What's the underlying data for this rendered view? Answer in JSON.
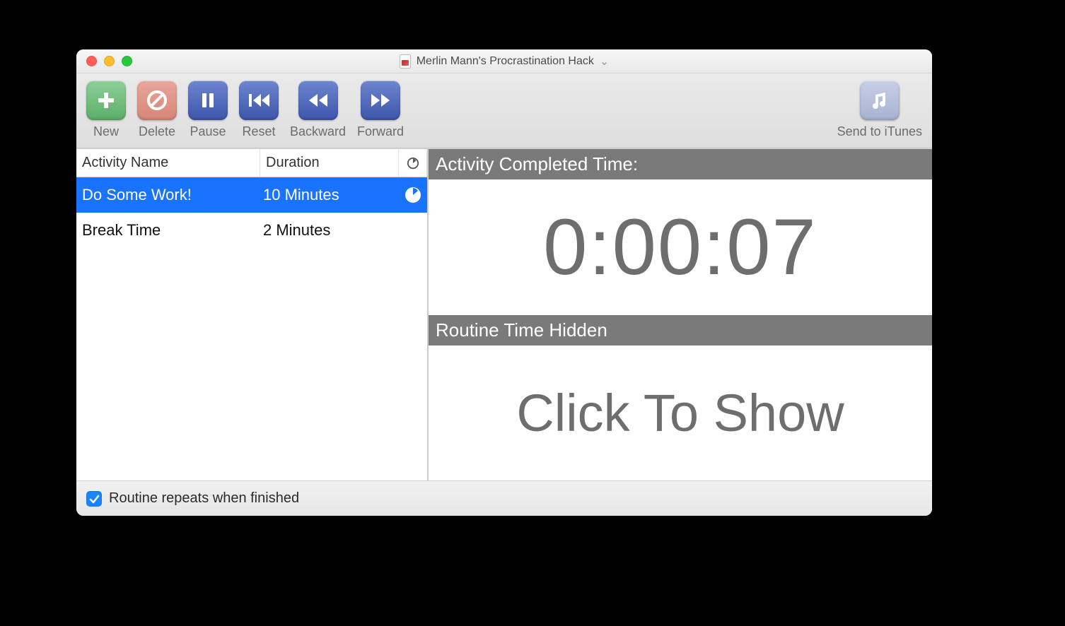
{
  "window": {
    "title": "Merlin Mann's Procrastination Hack"
  },
  "toolbar": {
    "new": "New",
    "delete": "Delete",
    "pause": "Pause",
    "reset": "Reset",
    "backward": "Backward",
    "forward": "Forward",
    "send_itunes": "Send to iTunes"
  },
  "table": {
    "col_name": "Activity Name",
    "col_duration": "Duration",
    "rows": [
      {
        "name": "Do Some Work!",
        "duration": "10 Minutes",
        "active": true
      },
      {
        "name": "Break Time",
        "duration": "2 Minutes",
        "active": false
      }
    ]
  },
  "panel": {
    "activity_label": "Activity Completed Time:",
    "activity_time": "0:00:07",
    "routine_label": "Routine Time Hidden",
    "routine_value": "Click To Show"
  },
  "footer": {
    "repeat_label": "Routine repeats when finished",
    "repeat_checked": true
  }
}
